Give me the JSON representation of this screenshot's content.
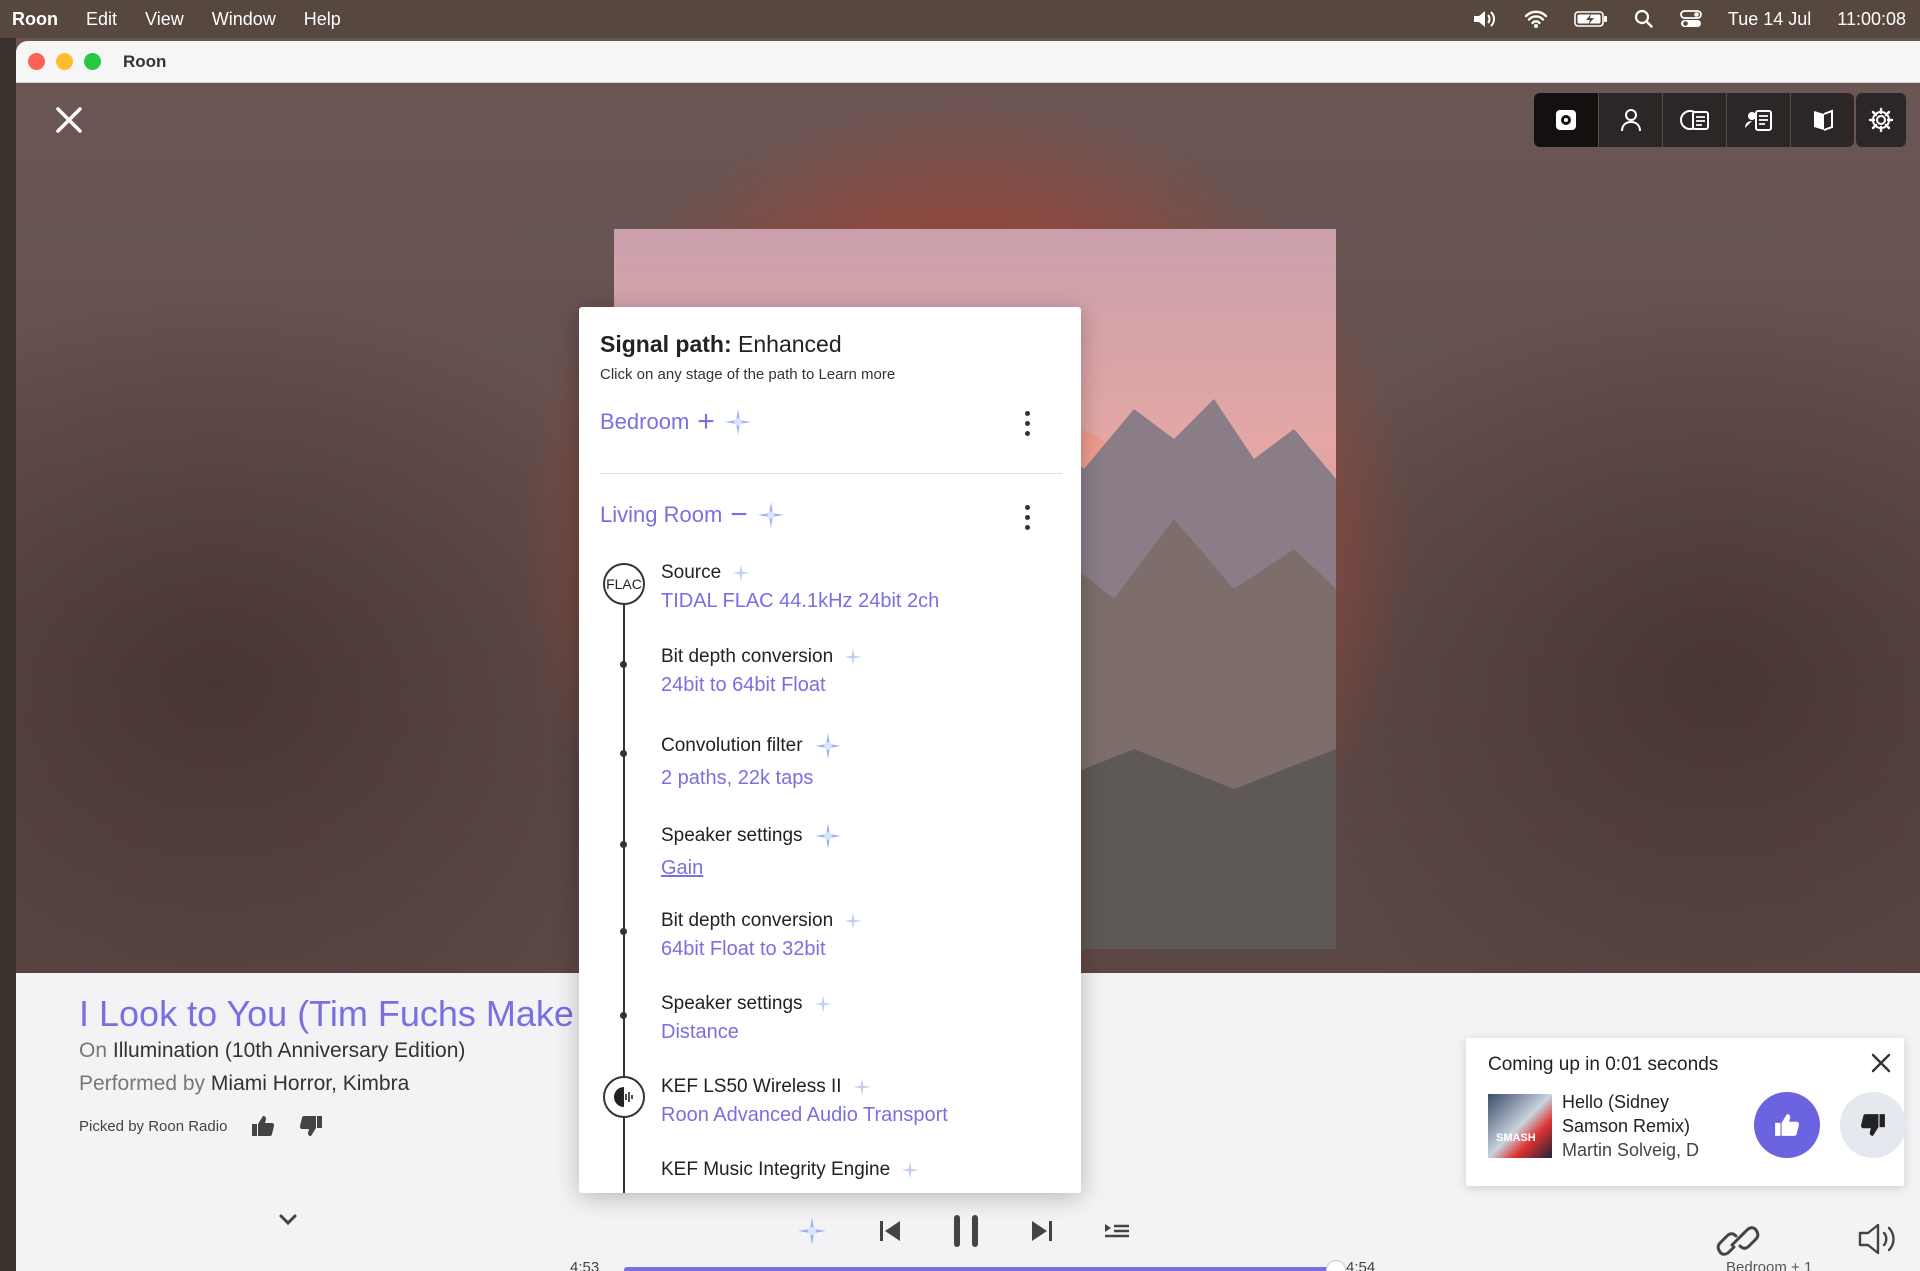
{
  "menubar": {
    "app": "Roon",
    "items": [
      "Edit",
      "View",
      "Window",
      "Help"
    ],
    "date": "Tue 14 Jul",
    "time": "11:00:08"
  },
  "window": {
    "title": "Roon"
  },
  "now_playing": {
    "title": "I Look to You (Tim Fuchs Make",
    "on_prefix": "On",
    "album": "Illumination (10th Anniversary Edition)",
    "performed_prefix": "Performed by",
    "artists": "Miami Horror, Kimbra",
    "picked_by": "Picked by Roon Radio",
    "elapsed": "4:53",
    "duration": "4:54",
    "progress_fraction": 0.997
  },
  "signal_path": {
    "title_bold": "Signal path:",
    "title_quality": "Enhanced",
    "subtitle": "Click on any stage of the path to Learn more",
    "zones": [
      {
        "name": "Bedroom",
        "toggle": "+"
      },
      {
        "name": "Living Room",
        "toggle": "−"
      }
    ],
    "source_node": "FLAC",
    "stages": [
      {
        "label": "Source",
        "value": "TIDAL FLAC 44.1kHz 24bit 2ch"
      },
      {
        "label": "Bit depth conversion",
        "value": "24bit to 64bit Float"
      },
      {
        "label": "Convolution filter",
        "value": "2 paths, 22k taps"
      },
      {
        "label": "Speaker settings",
        "value": "Gain"
      },
      {
        "label": "Bit depth conversion",
        "value": "64bit Float to 32bit"
      },
      {
        "label": "Speaker settings",
        "value": "Distance"
      },
      {
        "label": "KEF LS50 Wireless II",
        "value": "Roon Advanced Audio Transport"
      },
      {
        "label": "KEF Music Integrity Engine",
        "value": ""
      }
    ]
  },
  "up_next": {
    "header": "Coming up in 0:01 seconds",
    "song": "Hello (Sidney Samson Remix)",
    "artist": "Martin Solveig, D",
    "thumb_text": "SMASH"
  },
  "zone": {
    "label": "Bedroom + 1"
  },
  "colors": {
    "accent": "#7a6fe0",
    "like_button": "#6c63e0"
  }
}
